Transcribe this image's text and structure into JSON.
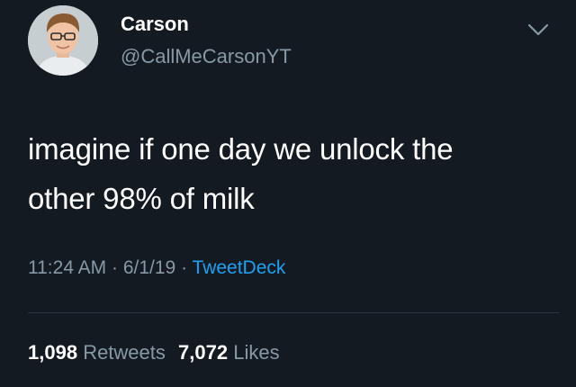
{
  "user": {
    "name": "Carson",
    "handle": "@CallMeCarsonYT"
  },
  "tweet": {
    "text_line1": "imagine if one day we unlock the",
    "text_line2": "other 98% of milk"
  },
  "meta": {
    "time": "11:24 AM",
    "sep1": " · ",
    "date": "6/1/19",
    "sep2": " · ",
    "source": "TweetDeck"
  },
  "stats": {
    "retweets_count": "1,098",
    "retweets_label": "Retweets",
    "likes_count": "7,072",
    "likes_label": "Likes"
  },
  "colors": {
    "background": "#141a22",
    "text": "#ffffff",
    "muted": "#8899a6",
    "link": "#1da1f2"
  },
  "icons": {
    "menu": "chevron-down-icon"
  }
}
